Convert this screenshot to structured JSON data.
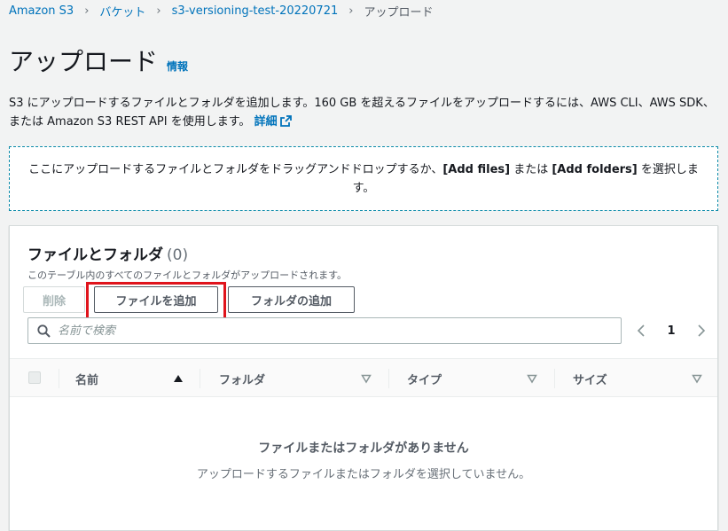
{
  "breadcrumb": {
    "items": [
      "Amazon S3",
      "バケット",
      "s3-versioning-test-20220721",
      "アップロード"
    ]
  },
  "page": {
    "title": "アップロード",
    "info_link": "情報",
    "description": "S3 にアップロードするファイルとフォルダを追加します。160 GB を超えるファイルをアップロードするには、AWS CLI、AWS SDK、または Amazon S3 REST API を使用します。",
    "detail_link": "詳細"
  },
  "dropzone": {
    "text_before": "ここにアップロードするファイルとフォルダをドラッグアンドドロップするか、",
    "add_files": "[Add files]",
    "text_middle": " または ",
    "add_folders": "[Add folders]",
    "text_after": " を選択します。"
  },
  "panel": {
    "title": "ファイルとフォルダ",
    "count": "(0)",
    "subtitle": "このテーブル内のすべてのファイルとフォルダがアップロードされます。",
    "delete_button": "削除",
    "add_files_button": "ファイルを追加",
    "add_folder_button": "フォルダの追加",
    "search_placeholder": "名前で検索",
    "page_number": "1"
  },
  "table": {
    "columns": [
      "名前",
      "フォルダ",
      "タイプ",
      "サイズ"
    ],
    "empty_title": "ファイルまたはフォルダがありません",
    "empty_subtitle": "アップロードするファイルまたはフォルダを選択していません。"
  },
  "colors": {
    "link": "#0073bb",
    "highlight": "#e0141c",
    "dropzone_border": "#0a8aa8"
  }
}
